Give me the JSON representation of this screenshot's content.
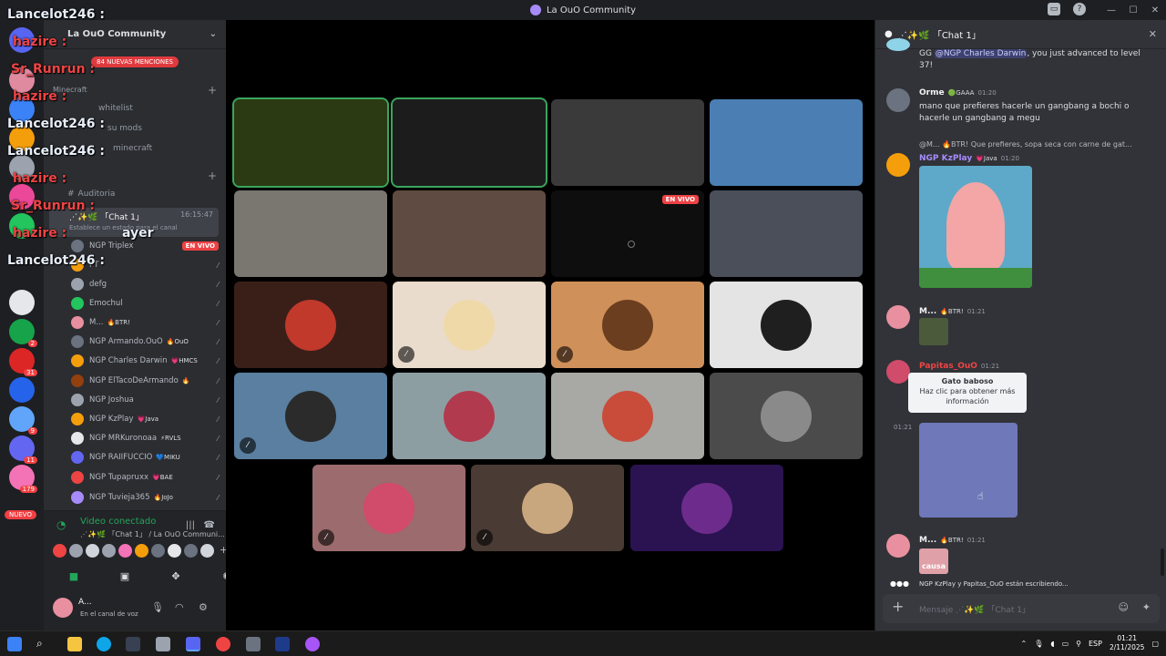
{
  "window": {
    "title": "La OuO Community"
  },
  "server": {
    "name": "La OuO Community",
    "mentions_badge": "84 NUEVAS MENCIONES",
    "new_badge": "NUEVO",
    "rail_badges": [
      "2",
      "31",
      "9",
      "11",
      "179"
    ]
  },
  "channels": {
    "category_minecraft": "Minecraft",
    "whitelist": "whitelist",
    "mods": "su mods",
    "minecraft": "minecraft",
    "auditoria": "Auditoria",
    "voice_channel": "⋰✨🌿 「Chat 1」",
    "voice_time": "16:15:47",
    "voice_status": "Establece un estado para el canal"
  },
  "members": [
    {
      "name": "NGP Triplex",
      "tag": "",
      "live": "EN VIVO"
    },
    {
      "name": "PT",
      "tag": ""
    },
    {
      "name": "defg",
      "tag": ""
    },
    {
      "name": "Emochul",
      "tag": ""
    },
    {
      "name": "M...",
      "tag": "🔥BTR!"
    },
    {
      "name": "NGP Armando.OuO",
      "tag": "🔥OuO"
    },
    {
      "name": "NGP Charles Darwin",
      "tag": "💗HMCS"
    },
    {
      "name": "NGP ElTacoDeArmando",
      "tag": "🔥"
    },
    {
      "name": "NGP Joshua",
      "tag": ""
    },
    {
      "name": "NGP KzPlay",
      "tag": "💗Java"
    },
    {
      "name": "NGP MRKuronoaa",
      "tag": "⚡RVLS"
    },
    {
      "name": "NGP RAIIFUCCIO",
      "tag": "💙MIKU"
    },
    {
      "name": "NGP Tupapruxx",
      "tag": "💗BAE"
    },
    {
      "name": "NGP Tuvieja365",
      "tag": "🔥JoJo"
    }
  ],
  "overlay_names": [
    {
      "text": "Lancelot246 :",
      "color": "white"
    },
    {
      "text": "hazire :",
      "color": "red"
    },
    {
      "text": "Sr_Runrun :",
      "color": "red"
    },
    {
      "text": "hazire :",
      "color": "red"
    },
    {
      "text": "Lancelot246 :",
      "color": "white"
    },
    {
      "text": "Lancelot246 :",
      "color": "white"
    },
    {
      "text": "hazire :",
      "color": "red"
    },
    {
      "text": "Sr_Runrun :",
      "color": "red"
    },
    {
      "text": "hazire :",
      "color": "red"
    },
    {
      "text": "ayer",
      "color": "white"
    },
    {
      "text": "Lancelot246 :",
      "color": "white"
    }
  ],
  "voice_panel": {
    "title": "Video conectado",
    "subtitle": "⋰✨🌿 「Chat 1」 / La OuO Communi...",
    "user_name": "A...",
    "user_status": "En el canal de voz"
  },
  "stage": {
    "live_label": "EN VIVO"
  },
  "chat": {
    "header": "⋰✨🌿 「Chat 1」",
    "messages": [
      {
        "text_a": "GG ",
        "mention": "@NGP Charles Darwin",
        "text_b": ", you just advanced to level 37!"
      },
      {
        "author": "Orme",
        "tag": "🟢GAAA",
        "time": "01:20",
        "text": "mano que prefieres hacerle un gangbang a bochi o hacerle un gangbang a megu"
      },
      {
        "reply": "@M... 🔥BTR!  Que prefieres, sopa seca con carne de gat...",
        "author": "NGP KzPlay",
        "tag": "💗Java",
        "time": "01:20"
      },
      {
        "author": "M...",
        "tag": "🔥BTR!",
        "time": "01:21"
      },
      {
        "author": "Papitas_OuO",
        "time": "01:21"
      },
      {
        "author": "M...",
        "tag": "🔥BTR!",
        "time": "01:21",
        "caption": "causa"
      }
    ],
    "tooltip_title": "Gato baboso",
    "tooltip_body": "Haz clic para obtener más información",
    "side_time": "01:21",
    "typing": "NGP KzPlay y Papitas_OuO están escribiendo...",
    "input_placeholder": "Mensaje ⋰✨🌿 「Chat 1」"
  },
  "taskbar": {
    "lang": "ESP",
    "time": "01:21",
    "date": "2/11/2025"
  }
}
